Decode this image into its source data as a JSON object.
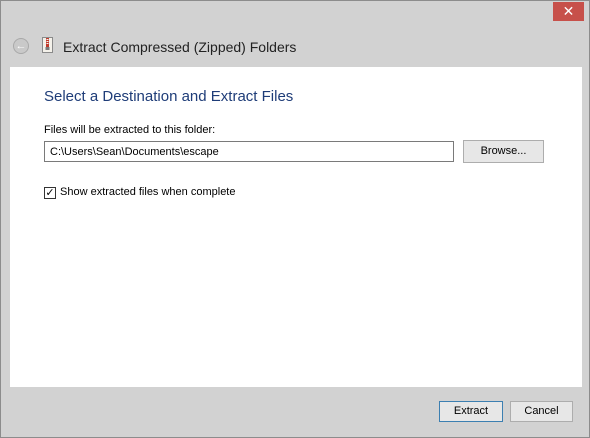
{
  "window": {
    "close_glyph": "✕"
  },
  "titlebar": {
    "back_icon": "back-arrow-icon",
    "app_icon": "zip-folder-icon",
    "title": "Extract Compressed (Zipped) Folders"
  },
  "main": {
    "heading": "Select a Destination and Extract Files",
    "destination_label": "Files will be extracted to this folder:",
    "destination_path": "C:\\Users\\Sean\\Documents\\escape",
    "browse_label": "Browse...",
    "show_files_checked": true,
    "show_files_label": "Show extracted files when complete"
  },
  "footer": {
    "extract_label": "Extract",
    "cancel_label": "Cancel"
  },
  "colors": {
    "close_button": "#c7504a",
    "heading": "#1e3c78",
    "default_button_border": "#3c7fb1"
  }
}
